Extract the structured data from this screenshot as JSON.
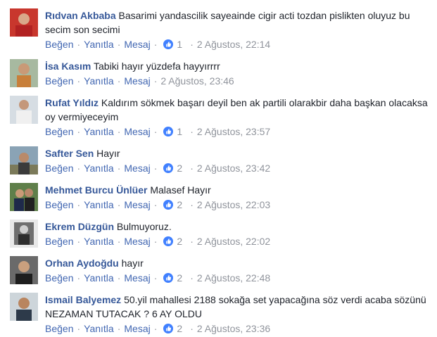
{
  "colors": {
    "author": "#365899",
    "action": "#4b4f56",
    "meta": "#90949c",
    "like": "#4080ff"
  },
  "action_labels": {
    "like": "Beğen",
    "reply": "Yanıtla",
    "message": "Mesaj",
    "dot": "·"
  },
  "comments": [
    {
      "author": "Rıdvan Akbaba",
      "text": "Basarimi yandascilik sayeainde cigir acti tozdan pislikten oluyuz bu secim son secimi",
      "likes": "1",
      "time": "2 Ağustos, 22:14"
    },
    {
      "author": "İsa Kasım",
      "text": "Tabiki hayır yüzdefa hayyırrrr",
      "likes": "",
      "time": "2 Ağustos, 23:46"
    },
    {
      "author": "Rufat Yıldız",
      "text": "Kaldırım sökmek başarı deyil ben ak partili olarakbir daha başkan olacaksa oy vermiyeceyim",
      "likes": "1",
      "time": "2 Ağustos, 23:57"
    },
    {
      "author": "Safter Sen",
      "text": "Hayır",
      "likes": "2",
      "time": "2 Ağustos, 23:42"
    },
    {
      "author": "Mehmet Burcu Ünlüer",
      "text": "Malasef Hayır",
      "likes": "2",
      "time": "2 Ağustos, 22:03"
    },
    {
      "author": "Ekrem Düzgün",
      "text": "Bulmuyoruz.",
      "likes": "2",
      "time": "2 Ağustos, 22:02"
    },
    {
      "author": "Orhan Aydoğdu",
      "text": "hayır",
      "likes": "2",
      "time": "2 Ağustos, 22:48"
    },
    {
      "author": "Ismail Balyemez",
      "text": "50.yil mahallesi 2188 sokağa set yapacağına söz verdi acaba sözünü NEZAMAN TUTACAK ? 6 AY OLDU",
      "likes": "2",
      "time": "2 Ağustos, 23:36"
    }
  ]
}
